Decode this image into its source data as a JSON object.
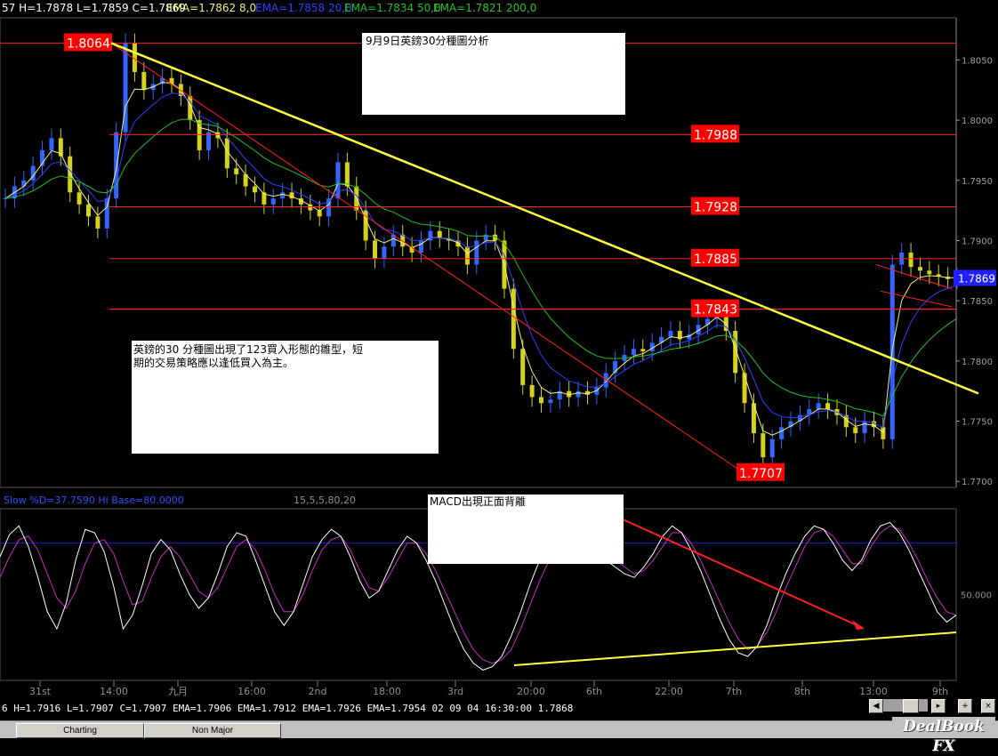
{
  "header": {
    "price_readout": "57 H=1.7878 L=1.7859 C=1.7869",
    "ema_8": "EMA=1.7862  8,0",
    "ema_20": "EMA=1.7858  20,0",
    "ema_50": "EMA=1.7834  50,0",
    "ema_200": "EMA=1.7821  200,0"
  },
  "colors": {
    "background": "#000000",
    "grid": "#404040",
    "candle_up": "#3366ff",
    "candle_down": "#d4d21a",
    "ema_8": "#f0f080",
    "ema_20": "#3040ff",
    "ema_50": "#20c020",
    "level_line": "#ff2020",
    "trend_line": "#ffff40",
    "label_bg": "#ff0000",
    "stoch_k": "#ffffff",
    "stoch_d": "#c030c0"
  },
  "chart_data": [
    {
      "type": "candlestick",
      "title": "",
      "price_axis_ticks": [
        "1.8050",
        "1.8000",
        "1.7950",
        "1.7900",
        "1.7850",
        "1.7800",
        "1.7750",
        "1.7700"
      ],
      "ylim": [
        1.7695,
        1.8085
      ],
      "x_labels": [
        "31st",
        "14:00",
        "九月",
        "16:00",
        "2nd",
        "18:00",
        "3rd",
        "20:00",
        "6th",
        "22:00",
        "7th",
        "8th",
        "13:00",
        "9th"
      ],
      "current_price": "1.7869",
      "closes": [
        1.7935,
        1.7945,
        1.795,
        1.7962,
        1.7975,
        1.7985,
        1.797,
        1.794,
        1.793,
        1.792,
        1.791,
        1.7935,
        1.799,
        1.8064,
        1.804,
        1.8025,
        1.803,
        1.8035,
        1.803,
        1.802,
        1.8,
        1.7975,
        1.799,
        1.7985,
        1.796,
        1.7955,
        1.7945,
        1.794,
        1.793,
        1.7935,
        1.794,
        1.7935,
        1.793,
        1.7925,
        1.792,
        1.7935,
        1.7965,
        1.7945,
        1.7925,
        1.79,
        1.7885,
        1.7895,
        1.7905,
        1.7895,
        1.789,
        1.79,
        1.7908,
        1.7902,
        1.79,
        1.7895,
        1.788,
        1.79,
        1.7905,
        1.79,
        1.786,
        1.781,
        1.778,
        1.777,
        1.7765,
        1.7768,
        1.7775,
        1.777,
        1.7775,
        1.7772,
        1.7778,
        1.779,
        1.78,
        1.7805,
        1.781,
        1.7808,
        1.7815,
        1.782,
        1.7825,
        1.7818,
        1.7822,
        1.783,
        1.7835,
        1.7843,
        1.7825,
        1.779,
        1.7765,
        1.774,
        1.772,
        1.7735,
        1.7745,
        1.775,
        1.7755,
        1.776,
        1.7765,
        1.776,
        1.7755,
        1.7745,
        1.774,
        1.775,
        1.7745,
        1.7735,
        1.788,
        1.789,
        1.7878,
        1.7875,
        1.7872,
        1.787,
        1.7868,
        1.7869
      ],
      "levels": [
        "1.8064",
        "1.7988",
        "1.7928",
        "1.7885",
        "1.7843",
        "1.7707"
      ],
      "annotations": [
        {
          "text": "9月9日英鎊30分種圖分析"
        },
        {
          "text": "英鎊的30 分種圖出現了123買入形態的雛型，短期的交易策略應以逢低買入為主。"
        }
      ]
    },
    {
      "type": "line",
      "title": "",
      "header": "Slow %D=37.7590 Hi Base=80.0000",
      "params": "15,5,5,80,20",
      "axis_ticks": [
        "50.000"
      ],
      "ylim": [
        0,
        100
      ],
      "hi_base": 80,
      "lo_base": 20,
      "k_values": [
        72,
        85,
        90,
        78,
        60,
        40,
        30,
        45,
        70,
        88,
        86,
        75,
        55,
        30,
        38,
        55,
        74,
        82,
        76,
        62,
        50,
        42,
        48,
        62,
        78,
        86,
        84,
        70,
        55,
        40,
        32,
        40,
        56,
        72,
        82,
        88,
        84,
        72,
        58,
        48,
        52,
        64,
        76,
        84,
        80,
        70,
        58,
        44,
        30,
        18,
        10,
        6,
        8,
        14,
        26,
        40,
        56,
        70,
        80,
        88,
        90,
        86,
        80,
        74,
        70,
        66,
        62,
        60,
        66,
        74,
        84,
        90,
        86,
        76,
        64,
        50,
        36,
        24,
        16,
        14,
        20,
        32,
        48,
        62,
        74,
        84,
        90,
        88,
        80,
        70,
        64,
        70,
        82,
        90,
        92,
        86,
        76,
        64,
        52,
        40,
        34,
        38
      ],
      "d_values": [
        60,
        72,
        82,
        84,
        76,
        62,
        48,
        42,
        52,
        68,
        80,
        82,
        74,
        58,
        44,
        46,
        60,
        72,
        78,
        72,
        62,
        52,
        48,
        54,
        66,
        78,
        82,
        76,
        64,
        50,
        40,
        40,
        50,
        64,
        76,
        82,
        84,
        76,
        64,
        54,
        52,
        60,
        70,
        80,
        80,
        74,
        64,
        52,
        40,
        28,
        18,
        12,
        10,
        12,
        18,
        30,
        44,
        58,
        70,
        80,
        86,
        86,
        82,
        78,
        74,
        70,
        66,
        62,
        64,
        70,
        78,
        86,
        86,
        80,
        70,
        58,
        46,
        34,
        24,
        18,
        20,
        28,
        40,
        54,
        66,
        78,
        86,
        88,
        84,
        76,
        68,
        68,
        78,
        86,
        90,
        88,
        80,
        70,
        58,
        48,
        40,
        38
      ],
      "annotations": [
        {
          "text": "MACD出現正面背離"
        }
      ]
    }
  ],
  "status": {
    "readout": "6 H=1.7916 L=1.7907 C=1.7907  EMA=1.7906 EMA=1.7912 EMA=1.7926 EMA=1.7954  02 09 04 16:30:00 1.7868"
  },
  "tabs": [
    {
      "label": "Charting"
    },
    {
      "label": "Non Major"
    }
  ],
  "brand": "DealBook FX"
}
